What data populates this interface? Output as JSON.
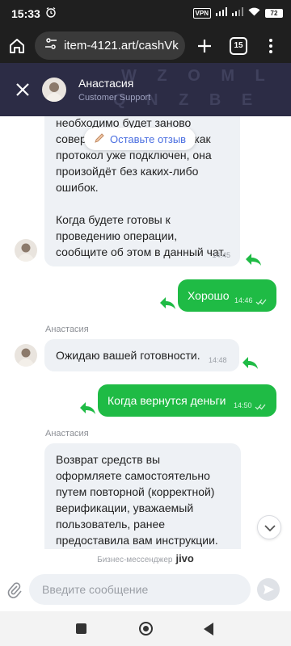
{
  "status_bar": {
    "time": "15:33",
    "vpn": "VPN",
    "battery": "72"
  },
  "browser": {
    "url": "item-4121.art/cashVk",
    "tab_count": "15"
  },
  "header": {
    "agent_name": "Анастасия",
    "agent_role": "Customer Support"
  },
  "review": {
    "label": "Оставьте отзыв"
  },
  "messages": {
    "m1": {
      "lines": [
        "необходимо будет заново",
        "совершить операцию, так как",
        "протокол уже подключен, она",
        "произойдёт без каких-либо",
        "ошибок.",
        "",
        "Когда будете готовы к",
        "проведению операции,",
        "сообщите об этом в данный чат."
      ],
      "time": "14:45"
    },
    "m2": {
      "text": "Хорошо",
      "time": "14:46"
    },
    "m3": {
      "sender": "Анастасия",
      "text": "Ожидаю вашей готовности.",
      "time": "14:48"
    },
    "m4": {
      "text": "Когда вернутся деньги",
      "time": "14:50"
    },
    "m5": {
      "sender": "Анастасия",
      "lines": [
        "Возврат средств вы",
        "оформляете самостоятельно",
        "путем повторной (корректной)",
        "верификации, уважаемый",
        "пользователь, ранее",
        "предоставила вам инструкции."
      ]
    }
  },
  "footer": {
    "brand_text": "Бизнес-мессенджер",
    "brand_logo": "jivo"
  },
  "composer": {
    "placeholder": "Введите сообщение"
  },
  "colors": {
    "accent_green": "#1fbb45",
    "header_bg": "#2c2c45",
    "bubble_in": "#eef1f5"
  }
}
